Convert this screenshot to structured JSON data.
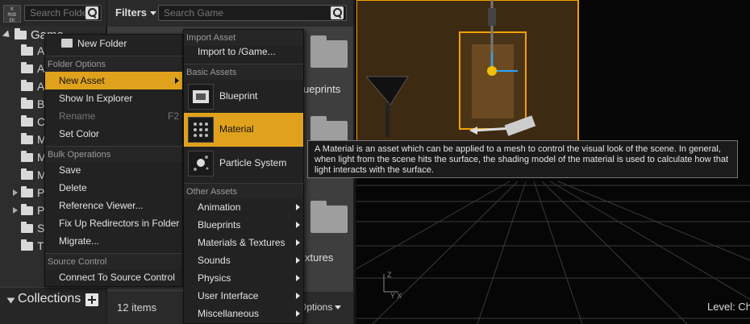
{
  "sources": {
    "search_placeholder": "Search Folde",
    "root_folder": "Game",
    "tree_items": [
      "A",
      "A",
      "A",
      "B",
      "C",
      "M",
      "M",
      "M",
      "P",
      "P",
      "S",
      "T"
    ]
  },
  "collections": {
    "label": "Collections"
  },
  "assets": {
    "filters_label": "Filters",
    "search_placeholder": "Search Game",
    "visible_captions": [
      "ueprints",
      "xtures"
    ],
    "items_count": "12 items",
    "view_options_label": "Options"
  },
  "viewport": {
    "level_label": "Level:  Ch"
  },
  "context_menu": {
    "new_folder": "New Folder",
    "folder_options_header": "Folder Options",
    "new_asset": "New Asset",
    "show_in_explorer": "Show In Explorer",
    "rename": "Rename",
    "rename_shortcut": "F2",
    "set_color": "Set Color",
    "bulk_operations_header": "Bulk Operations",
    "save": "Save",
    "delete": "Delete",
    "reference_viewer": "Reference Viewer...",
    "fix_up_redirectors": "Fix Up Redirectors in Folder",
    "migrate": "Migrate...",
    "source_control_header": "Source Control",
    "connect_source_control": "Connect To Source Control"
  },
  "submenu": {
    "import_asset_header": "Import Asset",
    "import_to_game": "Import to /Game...",
    "basic_assets_header": "Basic Assets",
    "blueprint": "Blueprint",
    "material": "Material",
    "particle_system": "Particle System",
    "other_assets_header": "Other Assets",
    "other_items": [
      "Animation",
      "Blueprints",
      "Materials & Textures",
      "Sounds",
      "Physics",
      "User Interface",
      "Miscellaneous"
    ]
  },
  "tooltip": {
    "text": "A Material is an asset which can be applied to a mesh to control the visual look of the scene. In general, when light from the scene hits the surface, the shading model of the material is used to calculate how that light interacts with the surface."
  },
  "colors": {
    "highlight": "#e0a21c",
    "selection_outline": "#f2a000",
    "menu_bg": "#222222"
  },
  "icons": {
    "search": "search-icon",
    "folder": "folder-icon",
    "add": "add-icon",
    "submenu": "chevron-right-icon"
  }
}
